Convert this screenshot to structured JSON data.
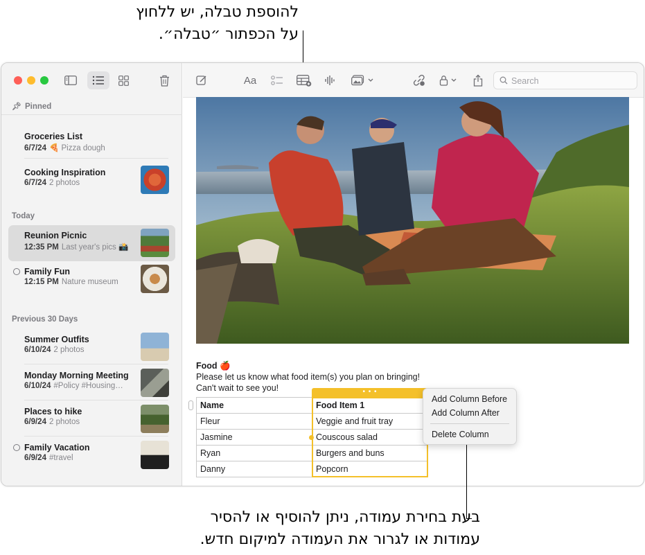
{
  "callouts": {
    "top": {
      "lines": [
        "להוספת טבלה, יש ללחוץ",
        "על הכפתור ״טבלה״."
      ]
    },
    "bottom": {
      "lines": [
        "בעת בחירת עמודה, ניתן להוסיף או להסיר",
        "עמודות או לגרור את העמודה למיקום חדש."
      ]
    }
  },
  "sidebar": {
    "sections": {
      "pinned": "Pinned",
      "today": "Today",
      "previous": "Previous 30 Days"
    },
    "notes": [
      {
        "title": "Groceries List",
        "date": "6/7/24",
        "snippet": "🍕 Pizza dough"
      },
      {
        "title": "Cooking Inspiration",
        "date": "6/7/24",
        "snippet": "2 photos"
      },
      {
        "title": "Reunion Picnic",
        "date": "12:35 PM",
        "snippet": "Last year's pics 📸"
      },
      {
        "title": "Family Fun",
        "date": "12:15 PM",
        "snippet": "Nature museum"
      },
      {
        "title": "Summer Outfits",
        "date": "6/10/24",
        "snippet": "2 photos"
      },
      {
        "title": "Monday Morning Meeting",
        "date": "6/10/24",
        "snippet": "#Policy #Housing…"
      },
      {
        "title": "Places to hike",
        "date": "6/9/24",
        "snippet": "2 photos"
      },
      {
        "title": "Family Vacation",
        "date": "6/9/24",
        "snippet": "#travel"
      }
    ]
  },
  "toolbar": {
    "format_label": "Aa",
    "search_placeholder": "Search"
  },
  "note": {
    "heading": "Food 🍎",
    "body_line1": "Please let us know what food item(s) you plan on bringing!",
    "body_line2": "Can't wait to see you!",
    "table": {
      "headers": [
        "Name",
        "Food Item 1"
      ],
      "rows": [
        [
          "Fleur",
          "Veggie and fruit tray"
        ],
        [
          "Jasmine",
          "Couscous salad"
        ],
        [
          "Ryan",
          "Burgers and buns"
        ],
        [
          "Danny",
          "Popcorn"
        ]
      ]
    },
    "column_handle": "• • •"
  },
  "context_menu": {
    "items": [
      "Add Column Before",
      "Add Column After",
      "Delete Column"
    ]
  },
  "colors": {
    "selection": "#f4c02a",
    "sidebar_bg": "#f3f3f3",
    "selected_note_bg": "#dcdcdc"
  }
}
